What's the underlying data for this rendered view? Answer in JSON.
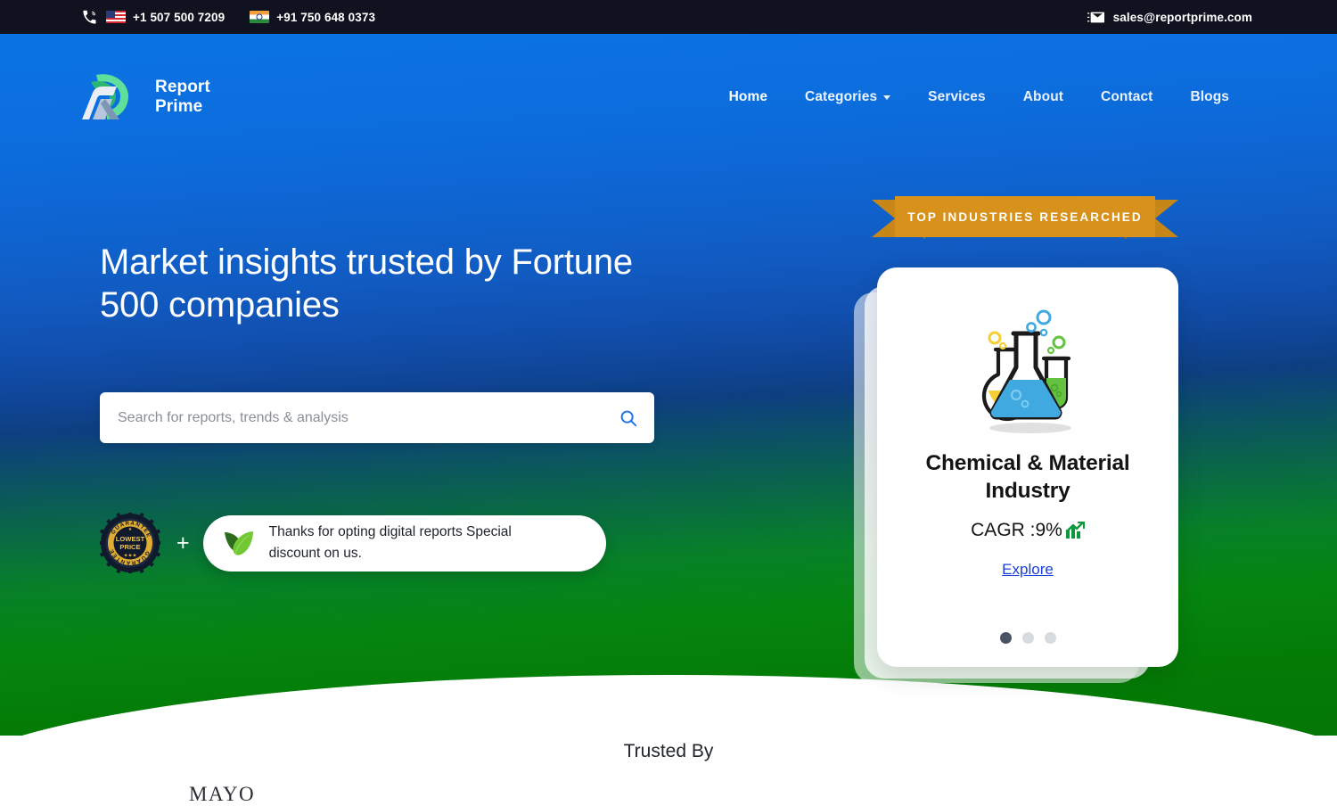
{
  "topbar": {
    "phone_icon": "phone-ring-icon",
    "email_icon": "envelope-icon",
    "phones": [
      {
        "flag": "us-flag-icon",
        "number": "+1 507 500 7209"
      },
      {
        "flag": "india-flag-icon",
        "number": "+91 750 648 0373"
      }
    ],
    "email": "sales@reportprime.com"
  },
  "brand": {
    "logo_icon": "report-prime-logo-icon",
    "line1": "Report",
    "line2": "Prime"
  },
  "nav": {
    "items": [
      {
        "label": "Home",
        "active": true,
        "has_caret": false
      },
      {
        "label": "Categories",
        "active": false,
        "has_caret": true
      },
      {
        "label": "Services",
        "active": false,
        "has_caret": false
      },
      {
        "label": "About",
        "active": false,
        "has_caret": false
      },
      {
        "label": "Contact",
        "active": false,
        "has_caret": false
      },
      {
        "label": "Blogs",
        "active": false,
        "has_caret": false
      }
    ]
  },
  "hero": {
    "title": "Market insights trusted by Fortune 500 companies",
    "search": {
      "placeholder": "Search for reports, trends & analysis",
      "value": "",
      "icon": "search-icon"
    },
    "promo": {
      "seal_icon": "lowest-price-guarantee-seal",
      "seal_arc_top": "GUARANTEE",
      "seal_arc_bottom": "GUARANTEE",
      "seal_line1": "LOWEST",
      "seal_line2": "PRICE",
      "plus": "+",
      "leaf_icon": "leaf-icon",
      "text": "Thanks for opting digital reports Special discount on us."
    }
  },
  "ribbon": {
    "text": "TOP INDUSTRIES RESEARCHED"
  },
  "card": {
    "illustration_icon": "chemistry-flasks-icon",
    "title": "Chemical & Material Industry",
    "cagr_label": "CAGR :9%",
    "cagr_icon": "chart-increasing-icon",
    "explore_label": "Explore",
    "dots": [
      true,
      false,
      false
    ]
  },
  "trusted": {
    "heading": "Trusted By",
    "logos": [
      "MAYO"
    ]
  },
  "colors": {
    "topbar_bg": "#10131f",
    "hero_blue": "#0b74e5",
    "hero_green": "#047605",
    "ribbon_amber": "#d8921b",
    "ribbon_amber_dark": "#c78618",
    "link_blue": "#1a3fd8",
    "search_icon_blue": "#1a73e8",
    "dot_active": "#4b5363"
  }
}
